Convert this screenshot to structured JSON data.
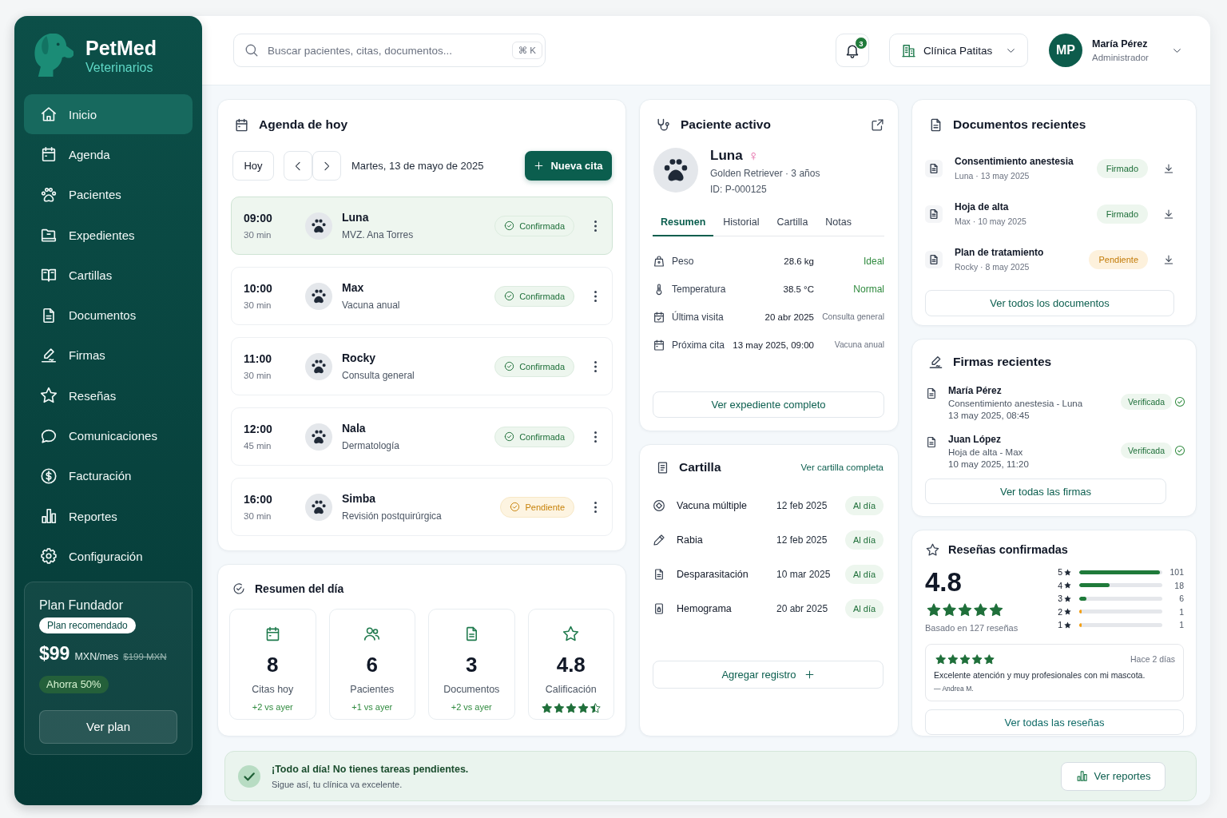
{
  "sidebar": {
    "brand": {
      "name": "PetMed",
      "tagline": "Veterinarios"
    },
    "nav": [
      {
        "label": "Inicio",
        "selected": true
      },
      {
        "label": "Agenda",
        "selected": false
      },
      {
        "label": "Pacientes",
        "selected": false
      },
      {
        "label": "Expedientes",
        "selected": false
      },
      {
        "label": "Cartillas",
        "selected": false
      },
      {
        "label": "Documentos",
        "selected": false
      },
      {
        "label": "Firmas",
        "selected": false
      },
      {
        "label": "Reseñas",
        "selected": false
      },
      {
        "label": "Comunicaciones",
        "selected": false
      },
      {
        "label": "Facturación",
        "selected": false
      },
      {
        "label": "Reportes",
        "selected": false
      },
      {
        "label": "Configuración",
        "selected": false
      }
    ],
    "plan": {
      "title": "Plan Fundador",
      "badge": "Plan recomendado",
      "price": "$99",
      "period": "MXN/mes",
      "old_price": "$199 MXN",
      "savings": "Ahorra 50%",
      "button": "Ver plan"
    }
  },
  "header": {
    "search": {
      "placeholder": "Buscar pacientes, citas, documentos...",
      "shortcut": "⌘ K"
    },
    "notifications": {
      "count": "3"
    },
    "clinic": "Clínica Patitas",
    "user": {
      "initials": "MP",
      "name": "María Pérez",
      "role": "Administrador"
    }
  },
  "agenda": {
    "title": "Agenda de hoy",
    "today_button": "Hoy",
    "date": "Martes, 13 de mayo de 2025",
    "new_button": "Nueva cita",
    "appointments": [
      {
        "time": "09:00",
        "duration": "30 min",
        "patient": "Luna",
        "detail": "MVZ. Ana Torres",
        "status": "Confirmada",
        "kind": "confirmed",
        "selected": true
      },
      {
        "time": "10:00",
        "duration": "30 min",
        "patient": "Max",
        "detail": "Vacuna anual",
        "status": "Confirmada",
        "kind": "confirmed",
        "selected": false
      },
      {
        "time": "11:00",
        "duration": "30 min",
        "patient": "Rocky",
        "detail": "Consulta general",
        "status": "Confirmada",
        "kind": "confirmed",
        "selected": false
      },
      {
        "time": "12:00",
        "duration": "45 min",
        "patient": "Nala",
        "detail": "Dermatología",
        "status": "Confirmada",
        "kind": "confirmed",
        "selected": false
      },
      {
        "time": "16:00",
        "duration": "30 min",
        "patient": "Simba",
        "detail": "Revisión postquirúrgica",
        "status": "Pendiente",
        "kind": "pending",
        "selected": false
      }
    ]
  },
  "summary": {
    "title": "Resumen del día",
    "stats": [
      {
        "kind": "trend",
        "value": "8",
        "label": "Citas hoy",
        "trend": "+2 vs ayer"
      },
      {
        "kind": "trend",
        "value": "6",
        "label": "Pacientes",
        "trend": "+1 vs ayer"
      },
      {
        "kind": "trend",
        "value": "3",
        "label": "Documentos",
        "trend": "+2 vs ayer"
      },
      {
        "kind": "rating",
        "value": "4.8",
        "label": "Calificación",
        "stars": 4.5
      }
    ]
  },
  "patient": {
    "title": "Paciente activo",
    "name": "Luna",
    "sex_symbol": "♀",
    "breed_age": "Golden Retriever · 3 años",
    "id": "ID: P-000125",
    "tabs": [
      {
        "label": "Resumen",
        "selected": true
      },
      {
        "label": "Historial",
        "selected": false
      },
      {
        "label": "Cartilla",
        "selected": false
      },
      {
        "label": "Notas",
        "selected": false
      }
    ],
    "vitals": [
      {
        "label": "Peso",
        "value": "28.6 kg",
        "note": "Ideal",
        "kind": "status"
      },
      {
        "label": "Temperatura",
        "value": "38.5 °C",
        "note": "Normal",
        "kind": "status"
      },
      {
        "label": "Última visita",
        "value": "20 abr 2025",
        "note": "Consulta general",
        "kind": "info"
      },
      {
        "label": "Próxima cita",
        "value": "13 may 2025, 09:00",
        "note": "Vacuna anual",
        "kind": "info"
      }
    ],
    "button": "Ver expediente completo"
  },
  "cartilla": {
    "title": "Cartilla",
    "link": "Ver cartilla completa",
    "items": [
      {
        "name": "Vacuna múltiple",
        "date": "12 feb 2025",
        "status": "Al día"
      },
      {
        "name": "Rabia",
        "date": "12 feb 2025",
        "status": "Al día"
      },
      {
        "name": "Desparasitación",
        "date": "10 mar 2025",
        "status": "Al día"
      },
      {
        "name": "Hemograma",
        "date": "20 abr 2025",
        "status": "Al día"
      }
    ],
    "button": "Agregar registro"
  },
  "documents": {
    "title": "Documentos recientes",
    "items": [
      {
        "title": "Consentimiento anestesia",
        "meta": "Luna · 13 may 2025",
        "status": "Firmado",
        "kind": "signed"
      },
      {
        "title": "Hoja de alta",
        "meta": "Max · 10 may 2025",
        "status": "Firmado",
        "kind": "signed"
      },
      {
        "title": "Plan de tratamiento",
        "meta": "Rocky · 8 may 2025",
        "status": "Pendiente",
        "kind": "pending"
      }
    ],
    "button": "Ver todos los documentos"
  },
  "signatures": {
    "title": "Firmas recientes",
    "items": [
      {
        "name": "María Pérez",
        "document": "Consentimiento anestesia - Luna",
        "datetime": "13 may 2025, 08:45",
        "status": "Verificada"
      },
      {
        "name": "Juan López",
        "document": "Hoja de alta - Max",
        "datetime": "10 may 2025, 11:20",
        "status": "Verificada"
      }
    ],
    "button": "Ver todas las firmas"
  },
  "reviews": {
    "title": "Reseñas confirmadas",
    "score": "4.8",
    "stars": 5,
    "based_on": "Basado en 127 reseñas",
    "distribution": [
      {
        "label": "5",
        "level": 0.97,
        "count": "101",
        "color": "#1f7a3a"
      },
      {
        "label": "4",
        "level": 0.37,
        "count": "18",
        "color": "#1f7a3a"
      },
      {
        "label": "3",
        "level": 0.09,
        "count": "6",
        "color": "#1f7a3a"
      },
      {
        "label": "2",
        "level": 0.03,
        "count": "1",
        "color": "#f59e0b"
      },
      {
        "label": "1",
        "level": 0.03,
        "count": "1",
        "color": "#f59e0b"
      }
    ],
    "latest": {
      "stars": 5,
      "time": "Hace 2 días",
      "text": "Excelente atención y muy profesionales con mi mascota.",
      "author": "— Andrea M."
    },
    "button": "Ver todas las reseñas"
  },
  "banner": {
    "title": "¡Todo al día! No tienes tareas pendientes.",
    "subtitle": "Sigue así, tu clínica va excelente.",
    "button": "Ver reportes"
  }
}
